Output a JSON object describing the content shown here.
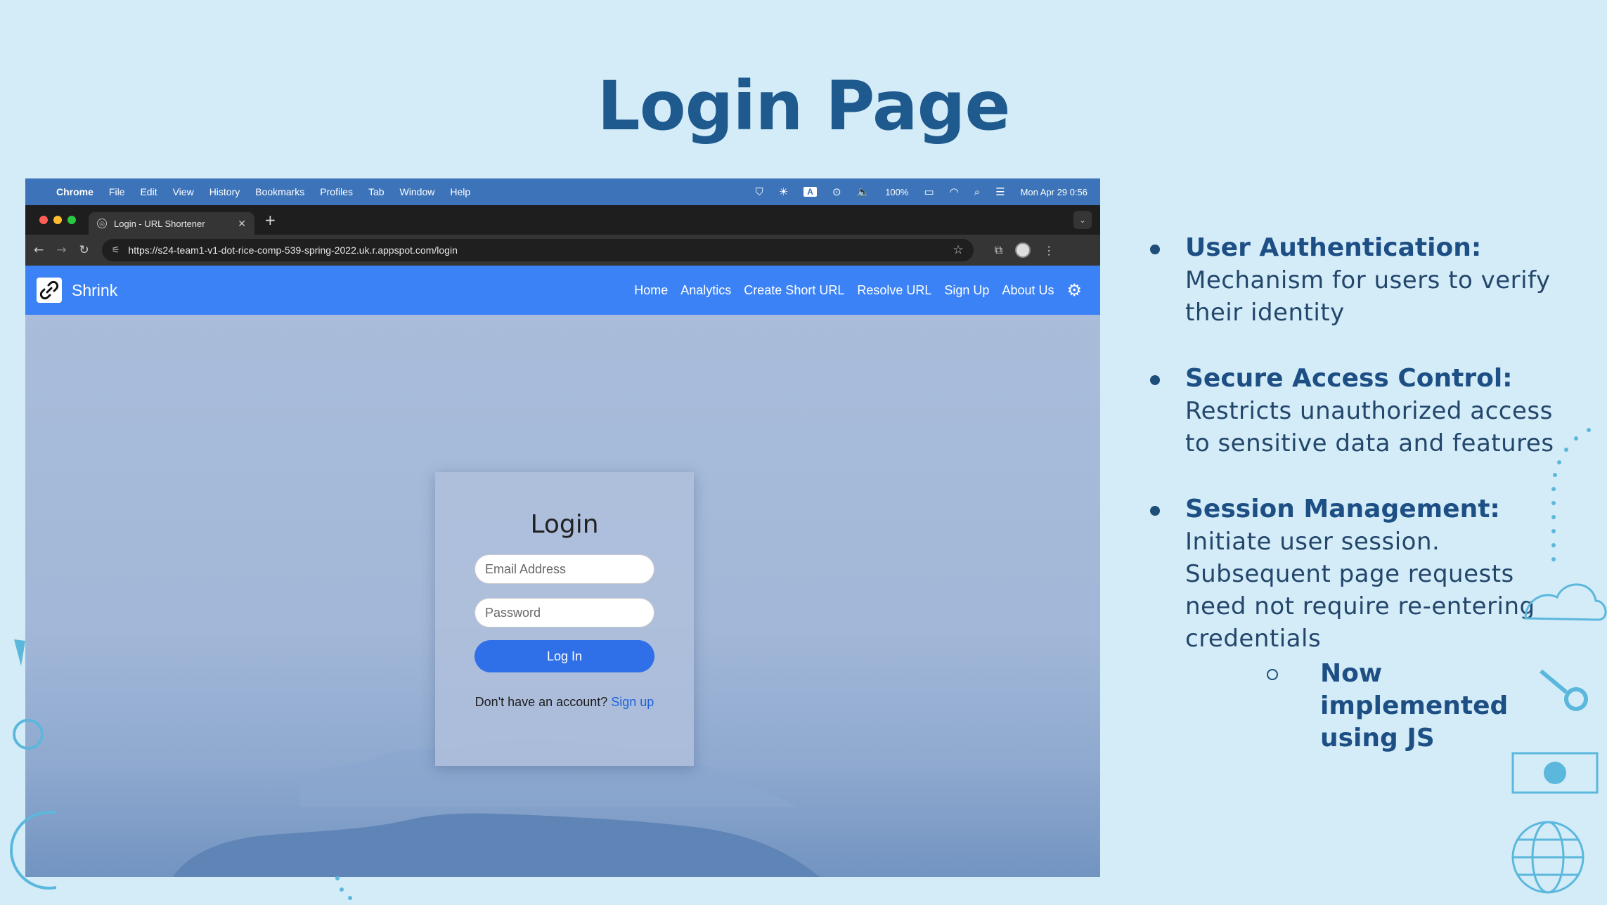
{
  "slide": {
    "title": "Login Page"
  },
  "mac_menubar": {
    "app": "Chrome",
    "menus": [
      "File",
      "Edit",
      "View",
      "History",
      "Bookmarks",
      "Profiles",
      "Tab",
      "Window",
      "Help"
    ],
    "battery": "100%",
    "datetime": "Mon Apr 29 0:56",
    "a_indicator": "A"
  },
  "browser": {
    "tab_title": "Login - URL Shortener",
    "url": "https://s24-team1-v1-dot-rice-comp-539-spring-2022.uk.r.appspot.com/login"
  },
  "site": {
    "brand": "Shrink",
    "nav": [
      "Home",
      "Analytics",
      "Create Short URL",
      "Resolve URL",
      "Sign Up",
      "About Us"
    ]
  },
  "login": {
    "heading": "Login",
    "email_placeholder": "Email Address",
    "password_placeholder": "Password",
    "button": "Log In",
    "signup_prompt": "Don't have an account?",
    "signup_link": "Sign up"
  },
  "bullets": [
    {
      "title": "User Authentication:",
      "desc": "Mechanism for users to verify their identity"
    },
    {
      "title": "Secure Access Control:",
      "desc": "Restricts unauthorized access to sensitive data and features"
    },
    {
      "title": "Session Management:",
      "desc": "Initiate user session. Subsequent page requests need not require re-entering credentials"
    }
  ],
  "sub_bullet": "Now implemented using JS",
  "colors": {
    "title": "#1f5a8f",
    "nav_bg": "#3b82f6",
    "button": "#2f6fe8",
    "slide_bg": "#d3ecf8"
  }
}
